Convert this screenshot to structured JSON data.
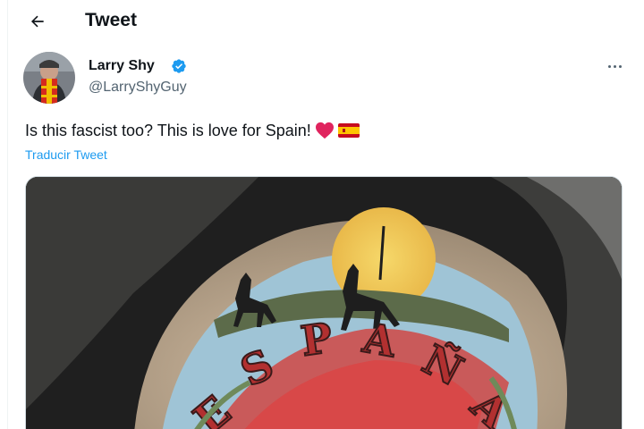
{
  "header": {
    "back_icon": "arrow-left-icon",
    "title": "Tweet"
  },
  "tweet": {
    "author": {
      "name": "Larry Shy",
      "handle": "@LarryShyGuy",
      "verified": true,
      "verified_color": "#1d9bf0"
    },
    "more_icon": "more-horizontal-icon",
    "text": "Is this fascist too? This is love for Spain!",
    "emojis": [
      "red-heart-icon",
      "spain-flag-icon"
    ],
    "translate_label": "Traducir Tweet",
    "media": {
      "tattoo_text": "ESPAÑA"
    }
  },
  "colors": {
    "text_primary": "#0f1419",
    "text_secondary": "#536471",
    "link": "#1d9bf0"
  }
}
